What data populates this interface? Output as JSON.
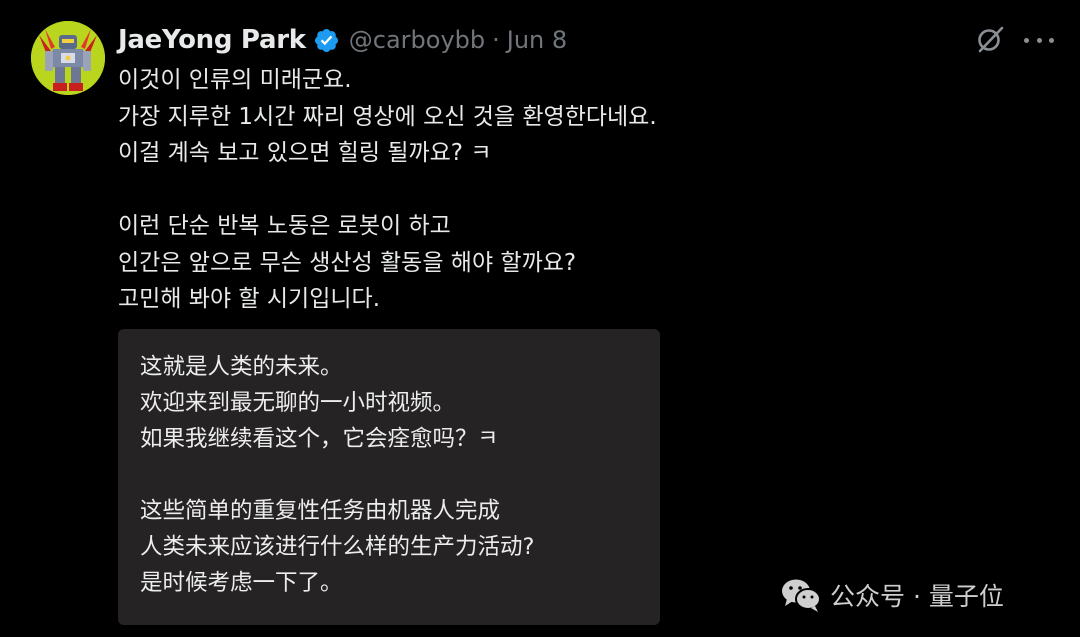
{
  "author": {
    "display_name": "JaeYong Park",
    "handle": "@carboybb",
    "separator": "·",
    "date": "Jun 8",
    "verified": true
  },
  "tweet": {
    "lines": [
      "이것이 인류의 미래군요.",
      "가장 지루한 1시간 짜리 영상에 오신 것을 환영한다네요.",
      "이걸 계속 보고 있으면 힐링 될까요? ㅋ",
      "",
      "이런 단순 반복 노동은 로봇이 하고",
      "인간은 앞으로 무슨 생산성 활동을 해야 할까요?",
      "고민해 봐야 할 시기입니다."
    ]
  },
  "translation": {
    "lines": [
      "这就是人类的未来。",
      "欢迎来到最无聊的一小时视频。",
      "如果我继续看这个，它会痊愈吗？ㅋ",
      "",
      "这些简单的重复性任务由机器人完成",
      "人类未来应该进行什么样的生产力活动?",
      "是时候考虑一下了。"
    ]
  },
  "watermark": {
    "text": "公众号 · 量子位",
    "icon": "wechat-icon"
  },
  "icons": {
    "top_right": [
      "grok-icon",
      "more-icon"
    ],
    "badge": "verified-badge-icon"
  },
  "colors": {
    "background": "#000000",
    "text": "#e7e9ea",
    "muted": "#71767b",
    "verified": "#1d9bf0",
    "card": "#252323",
    "avatar_bg": "#b9d51d"
  }
}
